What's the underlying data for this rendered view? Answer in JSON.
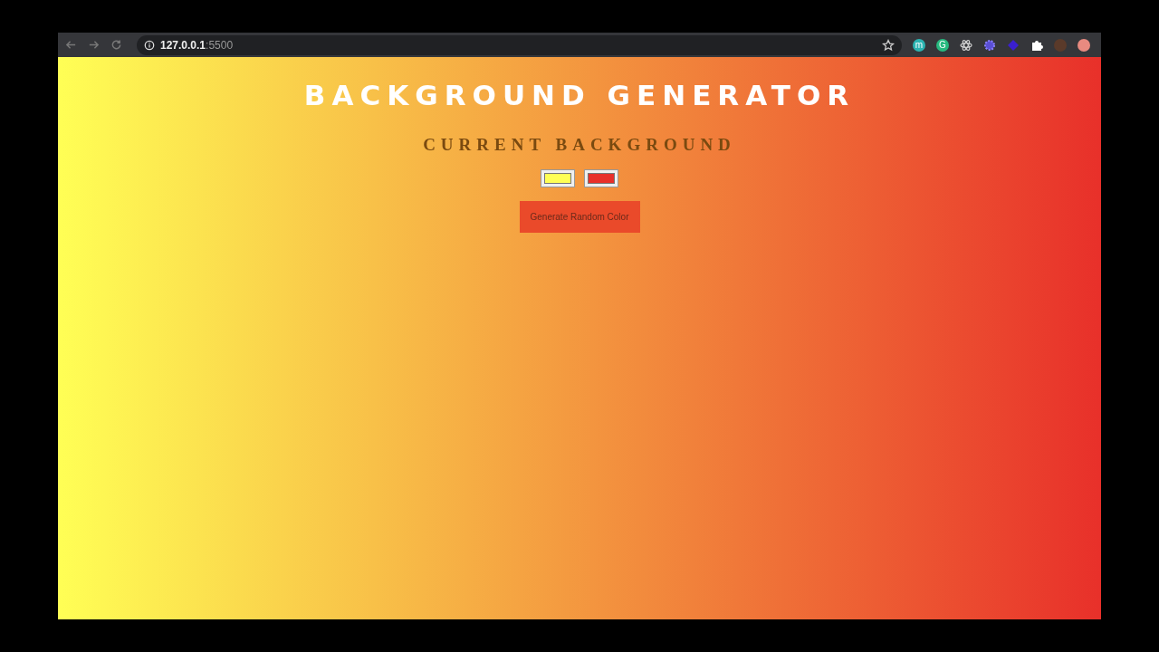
{
  "browser": {
    "url_host": "127.0.0.1",
    "url_port": ":5500",
    "extensions": [
      {
        "kind": "letter",
        "label": "m",
        "color": "#2bb3b1"
      },
      {
        "kind": "letter",
        "label": "G",
        "color": "#27b97f"
      },
      {
        "kind": "atom",
        "color": "#cfcfcf"
      },
      {
        "kind": "gear",
        "color": "#5a4fd6"
      },
      {
        "kind": "diamond",
        "color": "#3a1fd0"
      },
      {
        "kind": "puzzle",
        "color": "#ffffff"
      },
      {
        "kind": "avatar",
        "color": "#5a3a2a"
      },
      {
        "kind": "dot",
        "color": "#e88a80"
      }
    ]
  },
  "page": {
    "title": "BACKGROUND GENERATOR",
    "subtitle": "CURRENT BACKGROUND",
    "colors": [
      {
        "color": "#ffff55"
      },
      {
        "color": "#e8302a"
      }
    ],
    "button": "Generate Random Color"
  }
}
